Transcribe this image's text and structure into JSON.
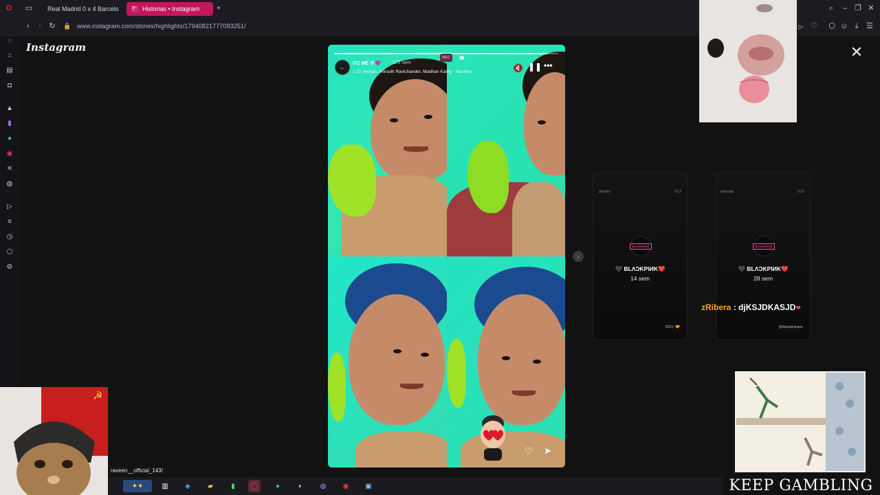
{
  "browser": {
    "tabs": [
      {
        "title": "Real Madrid 0 x 4 Barcelo",
        "icon": "youtube-icon",
        "color": "#ff0000"
      },
      {
        "title": "Historias • Instagram",
        "icon": "instagram-icon",
        "color": "#e1306c"
      }
    ],
    "new_tab": "+",
    "url": "www.instagram.com/stories/highlights/17940821777093251/"
  },
  "instagram": {
    "logo": "Instagram",
    "close": "✕",
    "story": {
      "username": "ITZ ME 😎💜",
      "time": "172 sem",
      "song": "D. Imman, Anirudh Ravichander, Madhan Karky · Nanbiye",
      "progress": 0.95,
      "rec_badge": "REC"
    },
    "previews": [
      {
        "username": "ghoolla",
        "duration": "0:12",
        "logo_text": "BLACKPINK",
        "name": "🖤 BLΛϽKPIИK❤️",
        "age": "14 sem",
        "footer": "2023 ♪🧡"
      },
      {
        "username": "jxiaoxige",
        "duration": "0:22",
        "logo_text": "BLACKPINK",
        "name": "🖤 BLΛϽKPIИK❤️",
        "age": "28 sem",
        "footer": "@blackpinkjane"
      }
    ]
  },
  "stream": {
    "cam_handle": "raveen__official_143/",
    "chat": {
      "user": "zRibera",
      "separator": " : ",
      "message": "djKSJDKASJD",
      "heart": "❤"
    },
    "meme_caption": "KEEP GAMBLING"
  },
  "colors": {
    "accent": "#c2185b",
    "tab_active": "#c2185b",
    "chat_user": "#f5a623"
  }
}
